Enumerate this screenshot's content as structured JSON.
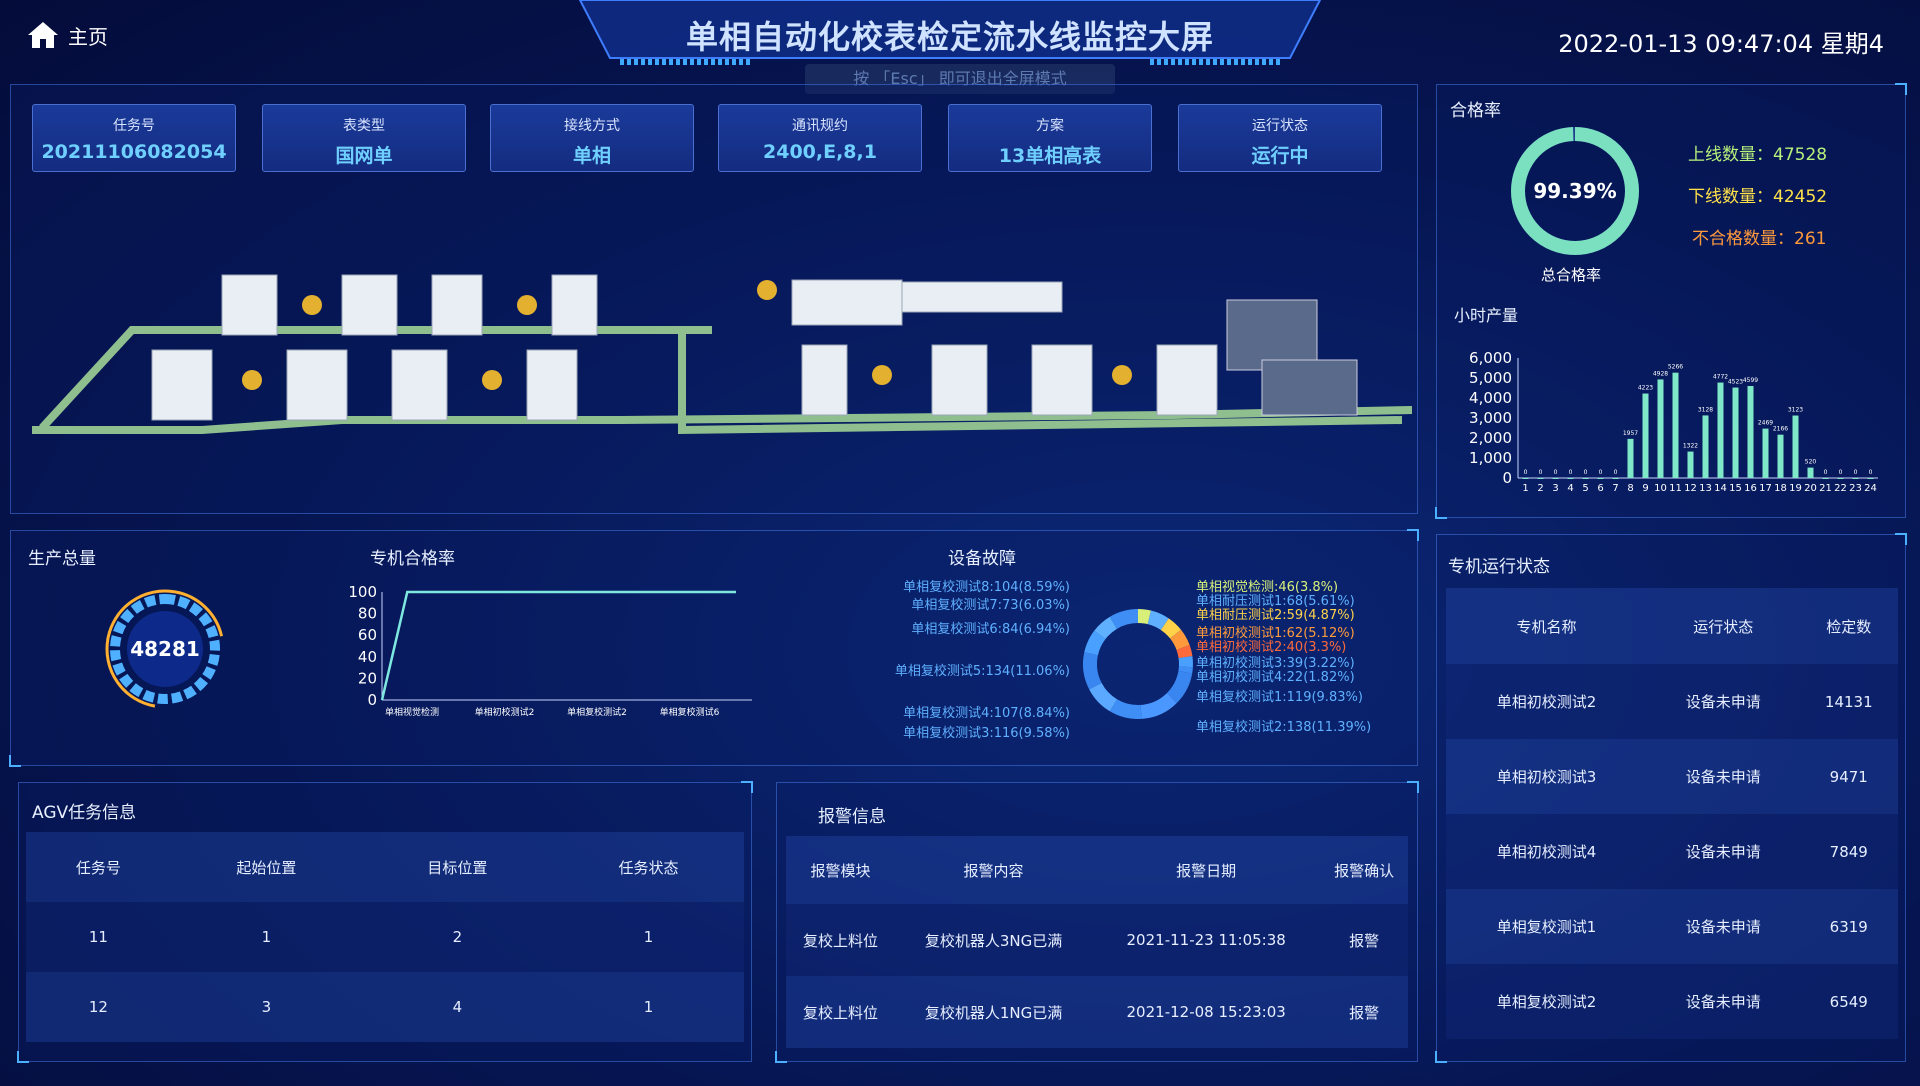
{
  "header": {
    "home_label": "主页",
    "title": "单相自动化校表检定流水线监控大屏",
    "fullscreen_hint": "按 「Esc」 即可退出全屏模式",
    "datetime": "2022-01-13 09:47:04 星期4"
  },
  "cards": [
    {
      "label": "任务号",
      "value": "20211106082054"
    },
    {
      "label": "表类型",
      "value": "国网单"
    },
    {
      "label": "接线方式",
      "value": "单相"
    },
    {
      "label": "通讯规约",
      "value": "2400,E,8,1"
    },
    {
      "label": "方案",
      "value": "13单相高表"
    },
    {
      "label": "运行状态",
      "value": "运行中"
    }
  ],
  "pass_rate": {
    "title": "合格率",
    "value": "99.39%",
    "fraction": 0.9939,
    "caption": "总合格率",
    "online_label": "上线数量：",
    "online_value": "47528",
    "offline_label": "下线数量：",
    "offline_value": "42452",
    "fail_label": "不合格数量：",
    "fail_value": "261",
    "colors": {
      "online": "#b7f07a",
      "offline": "#ffe14a",
      "fail": "#ff9a3c"
    }
  },
  "hourly": {
    "title": "小时产量"
  },
  "production": {
    "title": "生产总量",
    "value": "48281"
  },
  "machine_rate": {
    "title": "专机合格率"
  },
  "faults": {
    "title": "设备故障",
    "left_labels": [
      "单相复校测试8:104(8.59%)",
      "单相复校测试7:73(6.03%)",
      "单相复校测试6:84(6.94%)",
      "单相复校测试5:134(11.06%)",
      "单相复校测试4:107(8.84%)",
      "单相复校测试3:116(9.58%)"
    ],
    "right_labels": [
      {
        "text": "单相视觉检测:46(3.8%)",
        "color": "#d8f07a"
      },
      {
        "text": "单相耐压测试1:68(5.61%)",
        "color": "#5fb0ff"
      },
      {
        "text": "单相耐压测试2:59(4.87%)",
        "color": "#ffd24a"
      },
      {
        "text": "单相初校测试1:62(5.12%)",
        "color": "#ff9a3c"
      },
      {
        "text": "单相初校测试2:40(3.3%)",
        "color": "#ff6a3c"
      },
      {
        "text": "单相初校测试3:39(3.22%)",
        "color": "#5fb0ff"
      },
      {
        "text": "单相初校测试4:22(1.82%)",
        "color": "#5fb0ff"
      },
      {
        "text": "单相复校测试1:119(9.83%)",
        "color": "#5fb0ff"
      },
      {
        "text": "单相复校测试2:138(11.39%)",
        "color": "#5fb0ff"
      }
    ]
  },
  "machine_status": {
    "title": "专机运行状态",
    "headers": [
      "专机名称",
      "运行状态",
      "检定数"
    ],
    "rows": [
      [
        "单相初校测试2",
        "设备未申请",
        "14131"
      ],
      [
        "单相初校测试3",
        "设备未申请",
        "9471"
      ],
      [
        "单相初校测试4",
        "设备未申请",
        "7849"
      ],
      [
        "单相复校测试1",
        "设备未申请",
        "6319"
      ],
      [
        "单相复校测试2",
        "设备未申请",
        "6549"
      ]
    ]
  },
  "agv": {
    "title": "AGV任务信息",
    "headers": [
      "任务号",
      "起始位置",
      "目标位置",
      "任务状态"
    ],
    "rows": [
      [
        "11",
        "1",
        "2",
        "1"
      ],
      [
        "12",
        "3",
        "4",
        "1"
      ]
    ]
  },
  "alarms": {
    "title": "报警信息",
    "headers": [
      "报警模块",
      "报警内容",
      "报警日期",
      "报警确认"
    ],
    "rows": [
      [
        "复校上料位",
        "复校机器人3NG已满",
        "2021-11-23 11:05:38",
        "报警"
      ],
      [
        "复校上料位",
        "复校机器人1NG已满",
        "2021-12-08 15:23:03",
        "报警"
      ]
    ]
  },
  "chart_data": [
    {
      "type": "bar",
      "title": "小时产量",
      "categories": [
        "1",
        "2",
        "3",
        "4",
        "5",
        "6",
        "7",
        "8",
        "9",
        "10",
        "11",
        "12",
        "13",
        "14",
        "15",
        "16",
        "17",
        "18",
        "19",
        "20",
        "21",
        "22",
        "23",
        "24"
      ],
      "values": [
        0,
        0,
        0,
        0,
        0,
        0,
        0,
        1957,
        4223,
        4928,
        5266,
        1322,
        3128,
        4772,
        4523,
        4599,
        2469,
        2166,
        3123,
        520,
        0,
        0,
        0,
        0
      ],
      "data_labels": [
        "0",
        "0",
        "0",
        "0",
        "0",
        "0",
        "0",
        "1957",
        "4223",
        "4928",
        "5266",
        "1322",
        "3128",
        "4772",
        "4523",
        "4599",
        "2469",
        "2166",
        "3123",
        "520",
        "0",
        "0",
        "0",
        "0"
      ],
      "yticks": [
        "0",
        "1,000",
        "2,000",
        "3,000",
        "4,000",
        "5,000",
        "6,000"
      ],
      "ylim": [
        0,
        6000
      ]
    },
    {
      "type": "line",
      "title": "专机合格率",
      "x_labels": [
        "单相视觉检测",
        "单相初校测试2",
        "单相复校测试2",
        "单相复校测试6"
      ],
      "yticks": [
        "0",
        "20",
        "40",
        "60",
        "80",
        "100"
      ],
      "ylim": [
        0,
        100
      ],
      "values": [
        0,
        100,
        100,
        100,
        100,
        100,
        100,
        100,
        100,
        100,
        100,
        100,
        100,
        100,
        100
      ]
    },
    {
      "type": "pie",
      "title": "设备故障",
      "slices": [
        {
          "name": "单相视觉检测",
          "value": 46
        },
        {
          "name": "单相耐压测试1",
          "value": 68
        },
        {
          "name": "单相耐压测试2",
          "value": 59
        },
        {
          "name": "单相初校测试1",
          "value": 62
        },
        {
          "name": "单相初校测试2",
          "value": 40
        },
        {
          "name": "单相初校测试3",
          "value": 39
        },
        {
          "name": "单相初校测试4",
          "value": 22
        },
        {
          "name": "单相复校测试1",
          "value": 119
        },
        {
          "name": "单相复校测试2",
          "value": 138
        },
        {
          "name": "单相复校测试3",
          "value": 116
        },
        {
          "name": "单相复校测试4",
          "value": 107
        },
        {
          "name": "单相复校测试5",
          "value": 134
        },
        {
          "name": "单相复校测试6",
          "value": 84
        },
        {
          "name": "单相复校测试7",
          "value": 73
        },
        {
          "name": "单相复校测试8",
          "value": 104
        }
      ]
    }
  ]
}
